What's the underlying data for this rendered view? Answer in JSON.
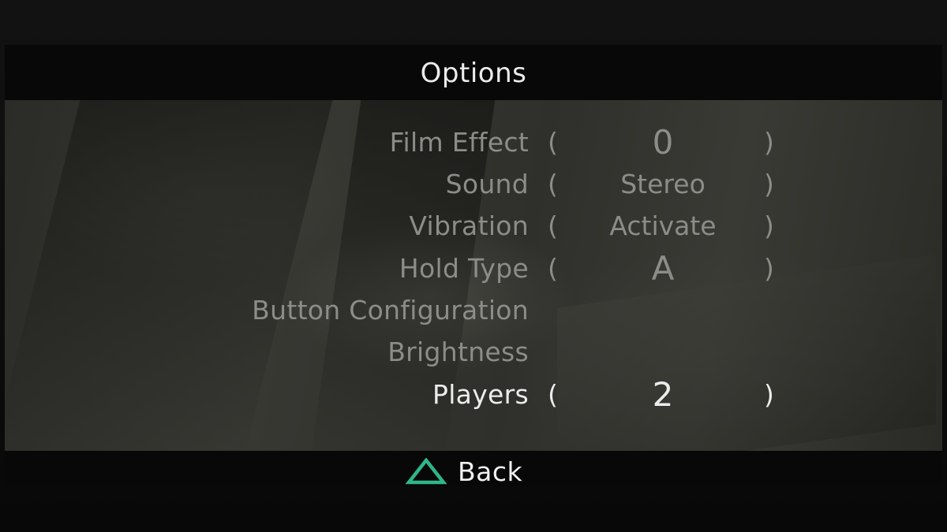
{
  "title": "Options",
  "options": [
    {
      "label": "Film Effect",
      "value": "0"
    },
    {
      "label": "Sound",
      "value": "Stereo"
    },
    {
      "label": "Vibration",
      "value": "Activate"
    },
    {
      "label": "Hold Type",
      "value": "A"
    },
    {
      "label": "Button Configuration"
    },
    {
      "label": "Brightness"
    },
    {
      "label": "Players",
      "value": "2"
    }
  ],
  "selected_option": "Players",
  "brackets": {
    "open": "(",
    "close": ")"
  },
  "footer": {
    "back_label": "Back",
    "back_icon": "triangle-icon"
  },
  "colors": {
    "selected_text": "#ececec",
    "unselected_text": "#8c8c88",
    "triangle": "#2fb58a",
    "bar": "#080808"
  }
}
